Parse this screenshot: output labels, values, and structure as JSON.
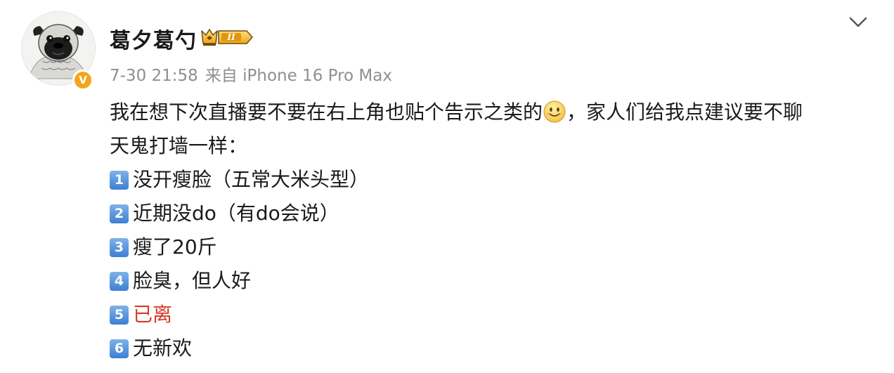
{
  "post": {
    "username": "葛夕葛勺",
    "member_badge": "II",
    "verified_mark": "V",
    "timestamp": "7-30 21:58",
    "source": "来自 iPhone 16 Pro Max",
    "text_part1": "我在想下次直播要不要在右上角也贴个告示之类的",
    "text_part2": "，家人们给我点建议要不聊",
    "text_line2": "天鬼打墙一样：",
    "items": [
      {
        "num": "1",
        "text": "没开瘦脸（五常大米头型）",
        "color": "#1a1a1a"
      },
      {
        "num": "2",
        "text": "近期没do（有do会说）",
        "color": "#1a1a1a"
      },
      {
        "num": "3",
        "text": "瘦了20斤",
        "color": "#1a1a1a"
      },
      {
        "num": "4",
        "text": "脸臭，但人好",
        "color": "#1a1a1a"
      },
      {
        "num": "5",
        "text": "已离",
        "color": "#d23c27"
      },
      {
        "num": "6",
        "text": "无新欢",
        "color": "#1a1a1a"
      }
    ],
    "icons": {
      "avatar": "pug-avatar",
      "verified": "verified-icon",
      "member": "crown-icon",
      "more": "chevron-down-icon",
      "emoji": "smiley-emoji"
    },
    "colors": {
      "text": "#1a1a1a",
      "meta": "#8f8f8f",
      "highlight": "#d23c27",
      "verified": "#f2a61c"
    }
  }
}
